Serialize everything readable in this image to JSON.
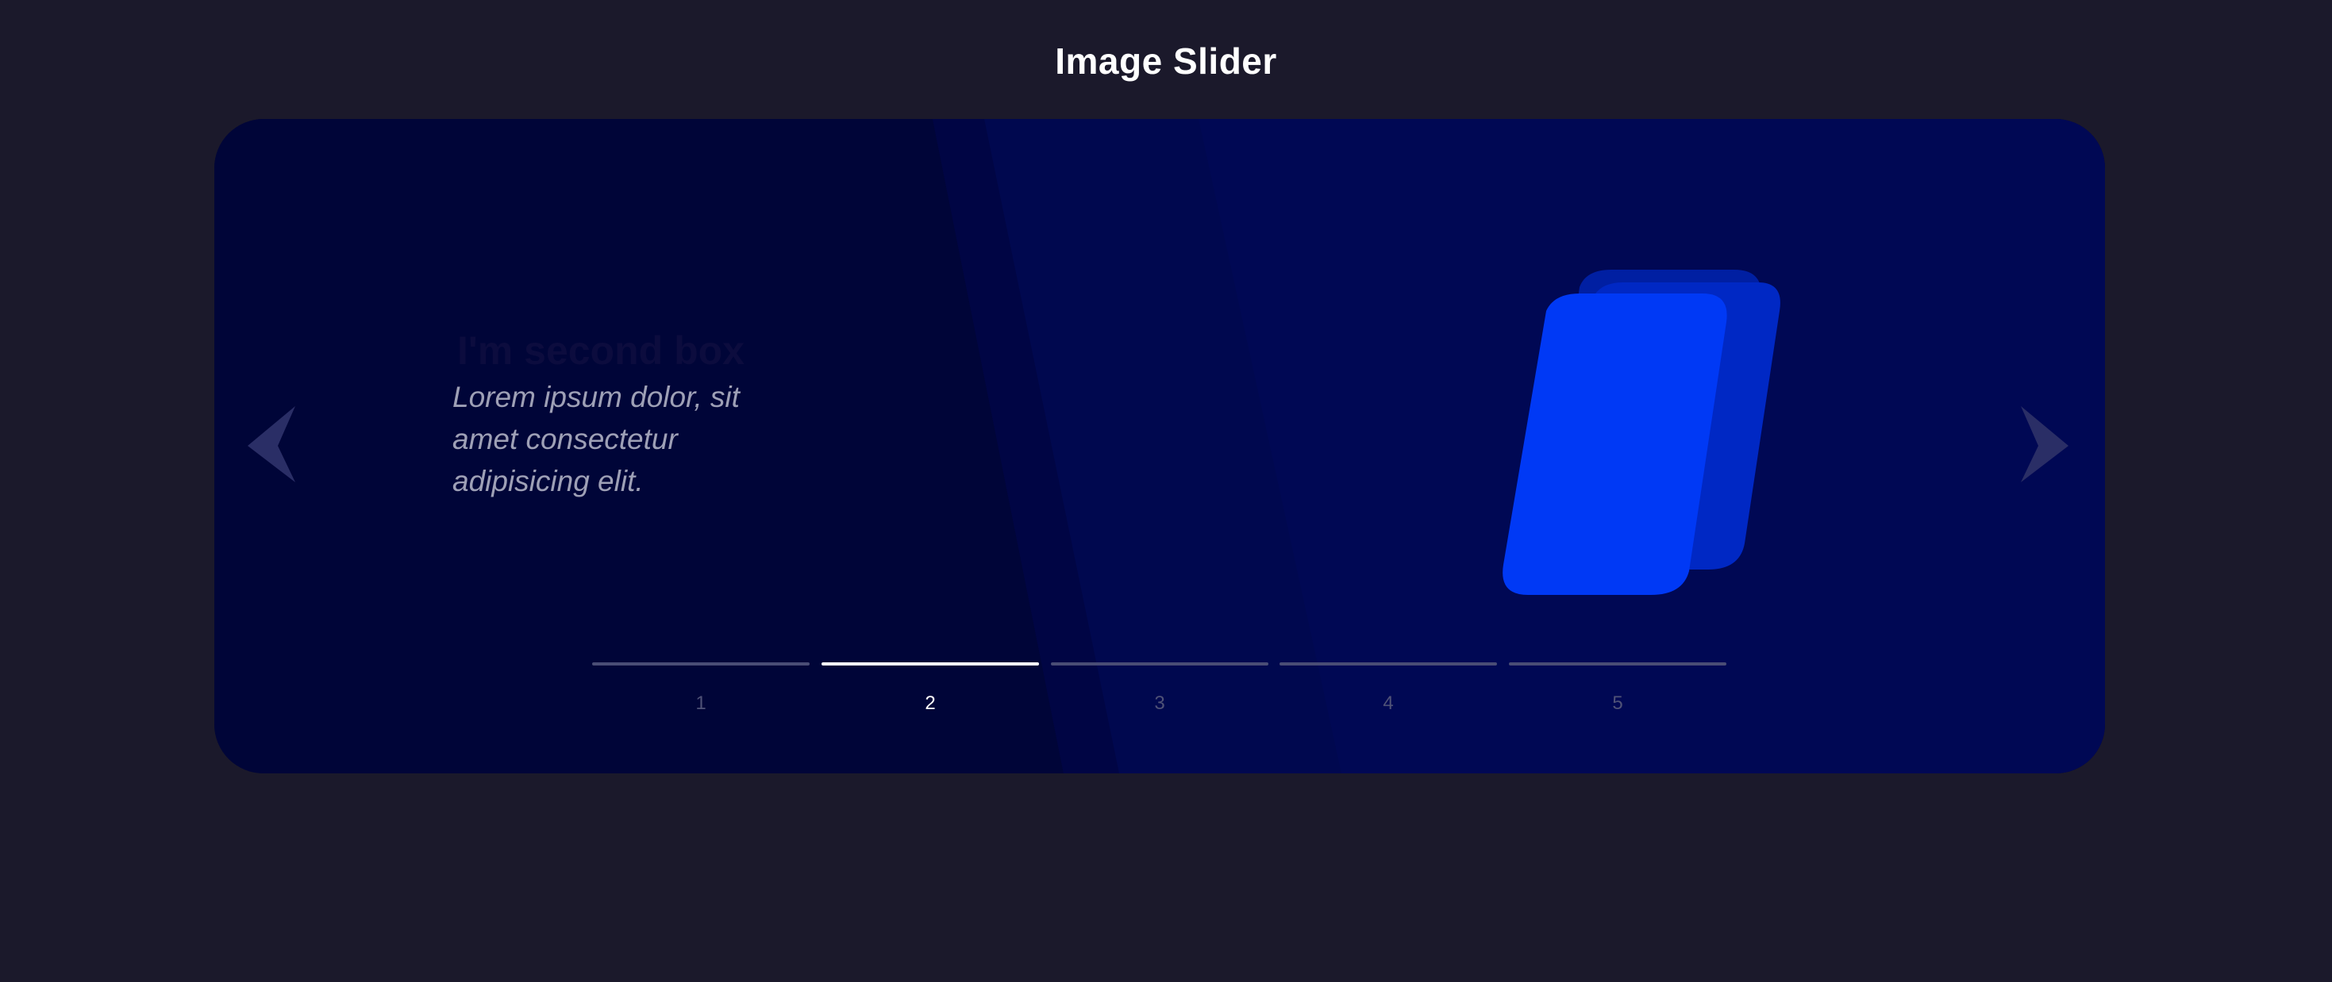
{
  "page": {
    "title": "Image Slider"
  },
  "slide": {
    "heading": "I'm second box",
    "body": "Lorem ipsum dolor, sit amet consectetur adipisicing elit."
  },
  "navigation": {
    "prev_icon": "chevron-left-icon",
    "next_icon": "chevron-right-icon"
  },
  "pager": {
    "active_index": 1,
    "items": [
      {
        "label": "1"
      },
      {
        "label": "2"
      },
      {
        "label": "3"
      },
      {
        "label": "4"
      },
      {
        "label": "5"
      }
    ]
  },
  "colors": {
    "page_background": "#1b192b",
    "slider_dark": "#000536",
    "slider_blue": "#000a58",
    "shape_primary": "#0039f5",
    "shape_secondary": "#0022b8",
    "pager_active": "#ffffff",
    "pager_inactive": "#4a4d75"
  }
}
